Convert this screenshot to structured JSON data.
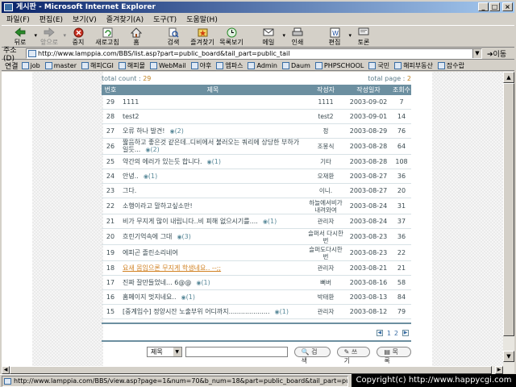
{
  "window": {
    "title": "게시판 - Microsoft Internet Explorer"
  },
  "menu": [
    "파일(F)",
    "편집(E)",
    "보기(V)",
    "즐겨찾기(A)",
    "도구(T)",
    "도움말(H)"
  ],
  "toolbar": [
    {
      "label": "뒤로",
      "icon": "back-arrow-icon",
      "disabled": false
    },
    {
      "label": "앞으로",
      "icon": "forward-arrow-icon",
      "disabled": true
    },
    {
      "label": "중지",
      "icon": "stop-icon",
      "disabled": false
    },
    {
      "label": "새로고침",
      "icon": "refresh-icon",
      "disabled": false
    },
    {
      "label": "홈",
      "icon": "home-icon",
      "disabled": false
    },
    {
      "label": "검색",
      "icon": "search-icon",
      "disabled": false
    },
    {
      "label": "즐겨찾기",
      "icon": "favorites-icon",
      "disabled": false
    },
    {
      "label": "목록보기",
      "icon": "history-icon",
      "disabled": false
    },
    {
      "label": "메일",
      "icon": "mail-icon",
      "disabled": false
    },
    {
      "label": "인쇄",
      "icon": "print-icon",
      "disabled": false
    },
    {
      "label": "편집",
      "icon": "edit-icon",
      "disabled": false
    },
    {
      "label": "토론",
      "icon": "discuss-icon",
      "disabled": false
    }
  ],
  "address": {
    "label": "주소(D)",
    "url": "http://www.lamppia.com/BBS/list.asp?part=public_board&tail_part=public_tail",
    "go": "이동"
  },
  "links": {
    "label": "연결",
    "items": [
      "job",
      "master",
      "해피CGI",
      "해피몰",
      "WebMail",
      "야후",
      "엠파스",
      "Admin",
      "Daum",
      "PHPSCHOOL",
      "국민",
      "해피부동산",
      "잡수랍"
    ]
  },
  "board": {
    "total_count_label": "total count : ",
    "total_count": "29",
    "total_page_label": "total page : ",
    "total_page": "2",
    "headers": [
      "번호",
      "제목",
      "작성자",
      "작성일자",
      "조회수"
    ],
    "rows": [
      {
        "num": "29",
        "title": "1111",
        "comments": "",
        "author": "1111",
        "date": "2003-09-02",
        "views": "7",
        "highlight": false,
        "tall": false
      },
      {
        "num": "28",
        "title": "test2",
        "comments": "",
        "author": "test2",
        "date": "2003-09-01",
        "views": "14",
        "highlight": false,
        "tall": false
      },
      {
        "num": "27",
        "title": "오류 하나 발견!",
        "comments": "(2)",
        "author": "정",
        "date": "2003-08-29",
        "views": "76",
        "highlight": false,
        "tall": false
      },
      {
        "num": "26",
        "title": "짧음하고 좋은것 같은데..디비에서 불러오는 쿼리에 상당한 부하가 일듯...",
        "comments": "(2)",
        "author": "조봉식",
        "date": "2003-08-28",
        "views": "64",
        "highlight": false,
        "tall": true
      },
      {
        "num": "25",
        "title": "약간의 에러가 있는듯 합니다.",
        "comments": "(1)",
        "author": "기타",
        "date": "2003-08-28",
        "views": "108",
        "highlight": false,
        "tall": false
      },
      {
        "num": "24",
        "title": "안녕..",
        "comments": "(1)",
        "author": "오재환",
        "date": "2003-08-27",
        "views": "36",
        "highlight": false,
        "tall": false
      },
      {
        "num": "23",
        "title": "그다.",
        "comments": "",
        "author": "이니.",
        "date": "2003-08-27",
        "views": "20",
        "highlight": false,
        "tall": false
      },
      {
        "num": "22",
        "title": "소행이라고 말하고싶소만!",
        "comments": "",
        "author": "하늘에서비가 내려와여",
        "date": "2003-08-24",
        "views": "31",
        "highlight": false,
        "tall": true
      },
      {
        "num": "21",
        "title": "비가 무지게 많이 내립니다..비 피해 없으시기를....",
        "comments": "(1)",
        "author": "관리자",
        "date": "2003-08-24",
        "views": "37",
        "highlight": false,
        "tall": false
      },
      {
        "num": "20",
        "title": "흐린기억속에 그대",
        "comments": "(3)",
        "author": "슬퍼서 다시한 번",
        "date": "2003-08-23",
        "views": "36",
        "highlight": false,
        "tall": true
      },
      {
        "num": "19",
        "title": "에피곤 졸린소리네여",
        "comments": "",
        "author": "슬퍼도다시한 번",
        "date": "2003-08-23",
        "views": "22",
        "highlight": false,
        "tall": true
      },
      {
        "num": "18",
        "title": "요새 몸임으론 무지게 학생네요.. --;;",
        "comments": "",
        "author": "관리자",
        "date": "2003-08-21",
        "views": "21",
        "highlight": true,
        "tall": false
      },
      {
        "num": "17",
        "title": "진짜 잘만들었네... 6@@",
        "comments": "(1)",
        "author": "뻐버",
        "date": "2003-08-16",
        "views": "58",
        "highlight": false,
        "tall": false
      },
      {
        "num": "16",
        "title": "홈페이지 멋지네요..",
        "comments": "(1)",
        "author": "박태환",
        "date": "2003-08-13",
        "views": "84",
        "highlight": false,
        "tall": false
      },
      {
        "num": "15",
        "title": "[중계입수] 정양시잔 노출부위 어디까지....................",
        "comments": "(1)",
        "author": "관리자",
        "date": "2003-08-12",
        "views": "79",
        "highlight": false,
        "tall": false
      }
    ],
    "pages": [
      "1",
      "2"
    ],
    "search": {
      "field": "제목",
      "buttons": [
        "검색",
        "쓰기",
        "목록"
      ]
    }
  },
  "status": {
    "text": "http://www.lamppia.com/BBS/view.asp?page=1&num=70&b_num=18&part=public_board&tail_part=public_tail"
  },
  "copyright": "Copyright(c) http://www.happycgi.com"
}
